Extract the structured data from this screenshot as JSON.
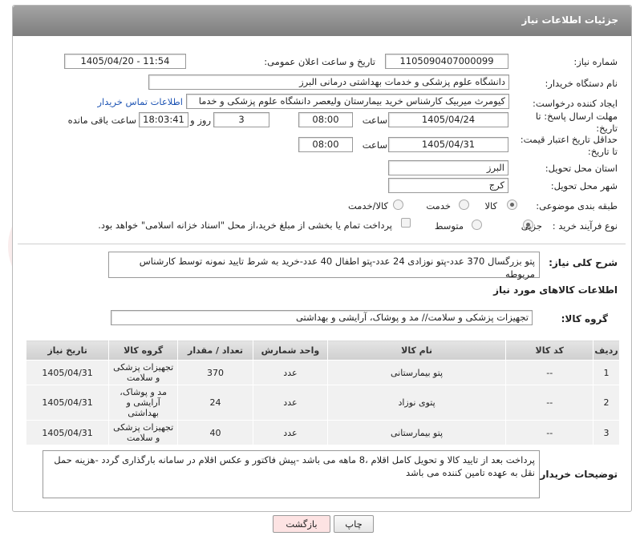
{
  "header": {
    "title": "جزئیات اطلاعات نیاز"
  },
  "form": {
    "need_number": {
      "label": "شماره نیاز:",
      "value": "1105090407000099"
    },
    "announce": {
      "label": "تاریخ و ساعت اعلان عمومی:",
      "value": "1405/04/20 - 11:54"
    },
    "buyer_org": {
      "label": "نام دستگاه خریدار:",
      "value": "دانشگاه علوم پزشکی و خدمات بهداشتی  درمانی البرز"
    },
    "requester": {
      "label": "ایجاد کننده درخواست:",
      "value": "کیومرث میربیک کارشناس خرید بیمارستان ولیعصر دانشگاه علوم پزشکی و خدما",
      "contact_link": "اطلاعات تماس خریدار"
    },
    "reply_deadline": {
      "label_line1": "مهلت ارسال پاسخ: تا",
      "label_line2": "تاریخ:",
      "date": "1405/04/24",
      "time_label": "ساعت",
      "time": "08:00",
      "days": "3",
      "days_label": "روز و",
      "remaining": "18:03:41",
      "remaining_label": "ساعت باقی مانده"
    },
    "price_validity": {
      "label_line1": "حداقل تاریخ اعتبار قیمت:",
      "label_line2": "تا تاریخ:",
      "date": "1405/04/31",
      "time_label": "ساعت",
      "time": "08:00"
    },
    "province": {
      "label": "استان محل تحویل:",
      "value": "البرز"
    },
    "city": {
      "label": "شهر محل تحویل:",
      "value": "کرج"
    },
    "category": {
      "label": "طبقه بندی موضوعی:",
      "options": [
        "کالا",
        "خدمت",
        "کالا/خدمت"
      ],
      "selected": "کالا"
    },
    "purchase_type": {
      "label": "نوع فرآیند خرید :",
      "options": [
        "جزیی",
        "متوسط"
      ],
      "selected": "جزیی",
      "payment_note": "پرداخت تمام یا بخشی از مبلغ خرید،از محل \"اسناد خزانه اسلامی\" خواهد بود."
    }
  },
  "summary": {
    "label": "شرح کلی نیاز:",
    "value": "پتو بزرگسال 370 عدد-پتو نوزادی 24 عدد-پتو اطفال 40 عدد-خرید به شرط تایید نمونه توسط کارشناس مربوطه"
  },
  "goods_section": {
    "title": "اطلاعات کالاهای مورد نیاز",
    "group_label": "گروه کالا:",
    "group_value": "تجهیزات پزشکی و سلامت// مد و پوشاک، آرایشی و بهداشتی"
  },
  "table": {
    "headers": [
      "ردیف",
      "کد کالا",
      "نام کالا",
      "واحد شمارش",
      "تعداد / مقدار",
      "گروه کالا",
      "تاریخ نیاز"
    ],
    "rows": [
      [
        "1",
        "--",
        "پتو بیمارستانی",
        "عدد",
        "370",
        "تجهیزات پزشکی و سلامت",
        "1405/04/31"
      ],
      [
        "2",
        "--",
        "پتوی نوزاد",
        "عدد",
        "24",
        "مد و پوشاک، آرایشی و بهداشتی",
        "1405/04/31"
      ],
      [
        "3",
        "--",
        "پتو بیمارستانی",
        "عدد",
        "40",
        "تجهیزات پزشکی و سلامت",
        "1405/04/31"
      ]
    ]
  },
  "buyer_notes": {
    "label": "توضیحات خریدار:",
    "value": "پرداخت بعد از تایید کالا و تحویل کامل اقلام ،8 ماهه می باشد -پیش فاکتور و عکس اقلام در سامانه بارگذاری گردد -هزینه حمل نقل به عهده تامین کننده می باشد"
  },
  "buttons": {
    "print": "چاپ",
    "back": "بازگشت"
  },
  "colors": {
    "header": "#8f8f8f",
    "link": "#1f55b4",
    "back_button": "#fde3e3"
  }
}
